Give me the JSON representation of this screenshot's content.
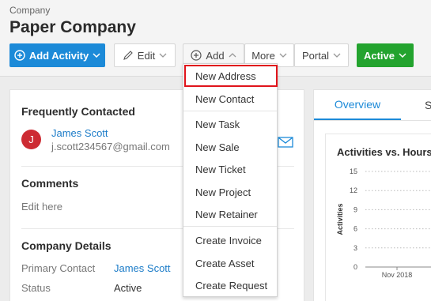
{
  "header": {
    "breadcrumb": "Company",
    "title": "Paper Company"
  },
  "toolbar": {
    "add_activity": "Add Activity",
    "edit": "Edit",
    "add": "Add",
    "more": "More",
    "portal": "Portal",
    "active": "Active"
  },
  "left_panel": {
    "frequently_contacted": "Frequently Contacted",
    "contact": {
      "initial": "J",
      "name": "James Scott",
      "email": "j.scott234567@gmail.com"
    },
    "comments_title": "Comments",
    "comments_placeholder": "Edit here",
    "company_details_title": "Company Details",
    "details": [
      {
        "label": "Primary Contact",
        "value": "James Scott"
      },
      {
        "label": "Status",
        "value": "Active"
      }
    ]
  },
  "right_panel": {
    "tabs": [
      "Overview",
      "S"
    ],
    "chart_title": "Activities vs. Hours"
  },
  "chart_data": {
    "type": "line",
    "title": "Activities vs. Hours",
    "ylabel": "Activities",
    "xlabel": "",
    "yticks": [
      0,
      3,
      6,
      9,
      12,
      15
    ],
    "ylim": [
      0,
      15
    ],
    "x_tick_labels": [
      "Nov 2018"
    ],
    "grid": true
  },
  "add_menu": {
    "items": [
      "New Address",
      "New Contact",
      "New Task",
      "New Sale",
      "New Ticket",
      "New Project",
      "New Retainer",
      "Create Invoice",
      "Create Asset",
      "Create Request"
    ],
    "highlighted_index": 0
  },
  "colors": {
    "primary_blue": "#1c8ad8",
    "active_green": "#23a32e",
    "avatar_red": "#cd2b33",
    "highlight_red": "#e0141b",
    "link_blue": "#1c7cc8"
  },
  "icons": {
    "add_activity": "plus-circle-icon",
    "edit": "pencil-icon",
    "add": "plus-circle-icon",
    "chevron": "chevron-down-icon",
    "chevron_up": "chevron-up-icon",
    "email": "envelope-icon"
  }
}
